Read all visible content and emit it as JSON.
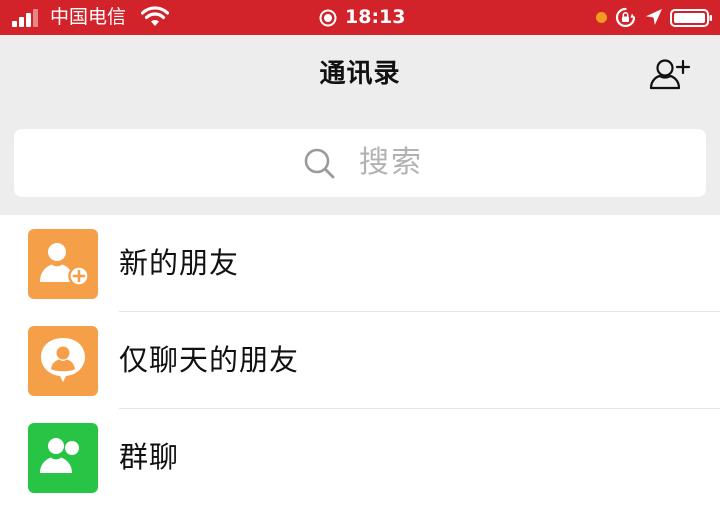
{
  "status_bar": {
    "carrier": "中国电信",
    "time": "18:13",
    "background_color": "#d2232a",
    "mic_indicator_color": "#f39a23",
    "icons": [
      "signal-icon",
      "wifi-icon",
      "screen-record-icon",
      "mic-indicator-dot",
      "rotation-lock-icon",
      "location-arrow-icon",
      "battery-icon"
    ]
  },
  "nav": {
    "title": "通讯录",
    "right_icon": "add-friend-icon"
  },
  "search": {
    "placeholder": "搜索",
    "icon": "search-icon"
  },
  "contacts_menu": {
    "items": [
      {
        "label": "新的朋友",
        "icon": "new-friend-icon",
        "color": "#f5a049"
      },
      {
        "label": "仅聊天的朋友",
        "icon": "chat-only-friend-icon",
        "color": "#f5a049"
      },
      {
        "label": "群聊",
        "icon": "group-chat-icon",
        "color": "#28c445"
      }
    ]
  }
}
